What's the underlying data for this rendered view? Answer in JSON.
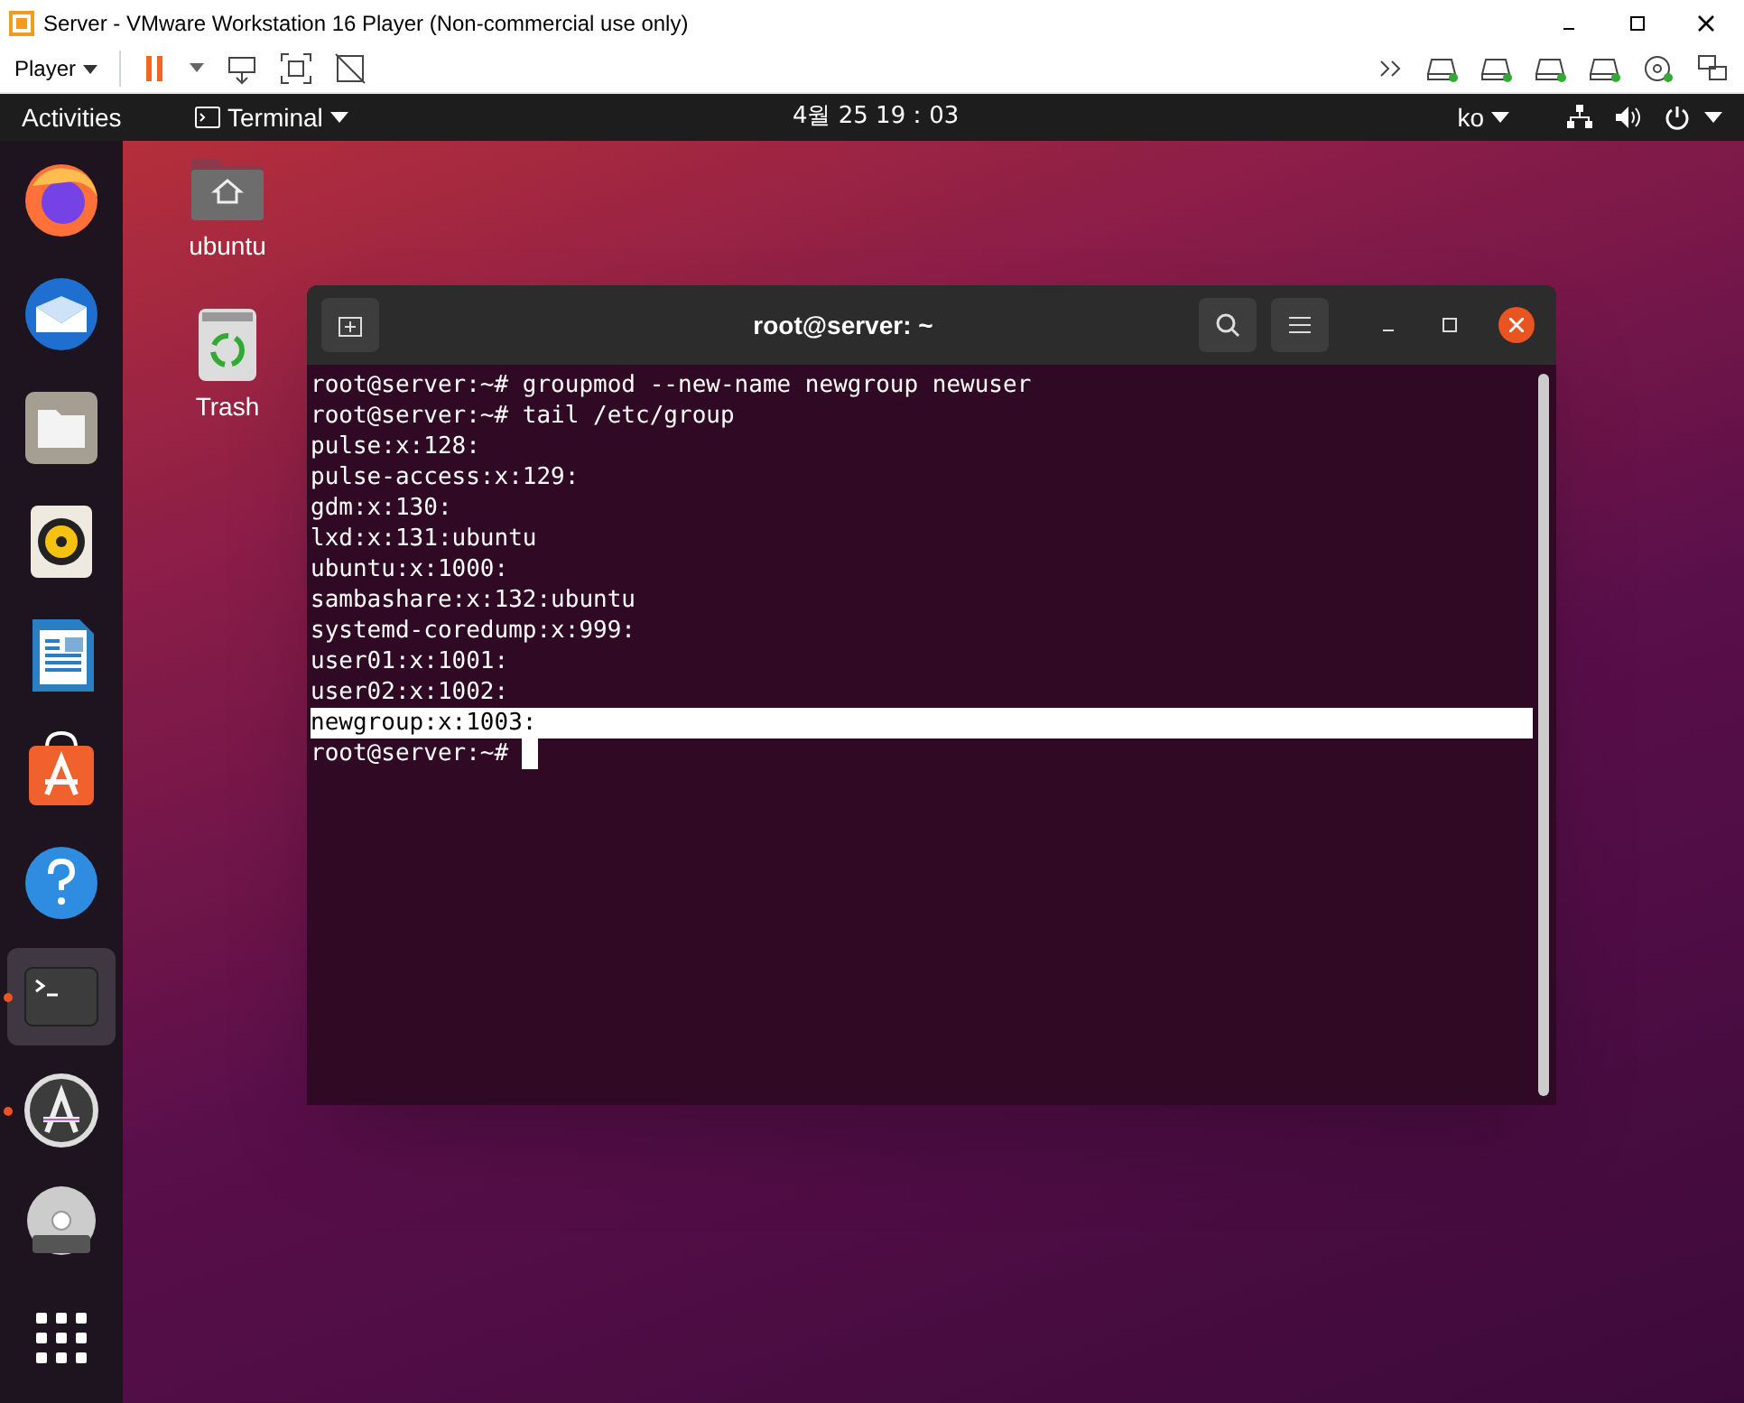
{
  "vm_window": {
    "title": "Server - VMware Workstation 16 Player (Non-commercial use only)"
  },
  "toolbar": {
    "player_menu": "Player"
  },
  "top_bar": {
    "activities": "Activities",
    "app_menu": "Terminal",
    "clock": "4월 25  19：03",
    "language": "ko"
  },
  "desktop_icons": [
    {
      "kind": "home",
      "label": "ubuntu"
    },
    {
      "kind": "trash",
      "label": "Trash"
    }
  ],
  "dock": [
    {
      "kind": "firefox",
      "running": false,
      "selected": false
    },
    {
      "kind": "mail",
      "running": false,
      "selected": false
    },
    {
      "kind": "files",
      "running": false,
      "selected": false
    },
    {
      "kind": "music",
      "running": false,
      "selected": false
    },
    {
      "kind": "writer",
      "running": false,
      "selected": false
    },
    {
      "kind": "store",
      "running": false,
      "selected": false
    },
    {
      "kind": "help",
      "running": false,
      "selected": false
    },
    {
      "kind": "terminal",
      "running": true,
      "selected": true
    },
    {
      "kind": "updater",
      "running": true,
      "selected": false
    },
    {
      "kind": "dvd",
      "running": false,
      "selected": false
    },
    {
      "kind": "apps",
      "running": false,
      "selected": false
    }
  ],
  "terminal": {
    "title": "root@server: ~",
    "cursor": true,
    "lines": [
      {
        "text": "root@server:~# groupmod --new-name newgroup newuser",
        "selected": false
      },
      {
        "text": "root@server:~# tail /etc/group",
        "selected": false
      },
      {
        "text": "pulse:x:128:",
        "selected": false
      },
      {
        "text": "pulse-access:x:129:",
        "selected": false
      },
      {
        "text": "gdm:x:130:",
        "selected": false
      },
      {
        "text": "lxd:x:131:ubuntu",
        "selected": false
      },
      {
        "text": "ubuntu:x:1000:",
        "selected": false
      },
      {
        "text": "sambashare:x:132:ubuntu",
        "selected": false
      },
      {
        "text": "systemd-coredump:x:999:",
        "selected": false
      },
      {
        "text": "user01:x:1001:",
        "selected": false
      },
      {
        "text": "user02:x:1002:",
        "selected": false
      },
      {
        "text": "newgroup:x:1003:",
        "selected": true
      },
      {
        "text": "root@server:~# ",
        "selected": false
      }
    ]
  }
}
